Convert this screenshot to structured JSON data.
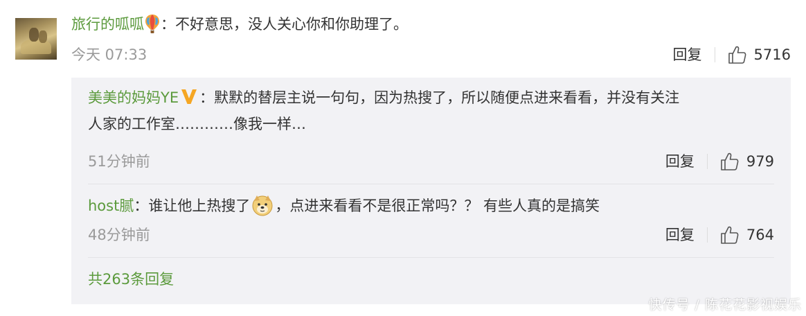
{
  "comment": {
    "username": "旅行的呱呱",
    "colon": "：",
    "text": "不好意思，没人关心你和你助理了。",
    "time": "今天 07:33",
    "reply_label": "回复",
    "likes": "5716"
  },
  "replies": [
    {
      "username": "美美的妈妈YE",
      "colon": "：",
      "text_line1": "默默的替层主说一句句，因为热搜了，所以随便点进来看看，并没有关注",
      "text_line2": "人家的工作室…………像我一样…",
      "time": "51分钟前",
      "reply_label": "回复",
      "likes": "979"
    },
    {
      "username": "host腻",
      "colon": "：",
      "text_before": "谁让他上热搜了",
      "text_after": "，点进来看看不是很正常吗？？ 有些人真的是搞笑",
      "time": "48分钟前",
      "reply_label": "回复",
      "likes": "764"
    }
  ],
  "total_replies": "共263条回复",
  "watermark": "快传号 / 陈花花影视娱乐",
  "colors": {
    "username": "#5b9a3c",
    "time": "#9a9a9a",
    "reply_bg": "#f2f2f5",
    "verified": "#f5a623"
  }
}
